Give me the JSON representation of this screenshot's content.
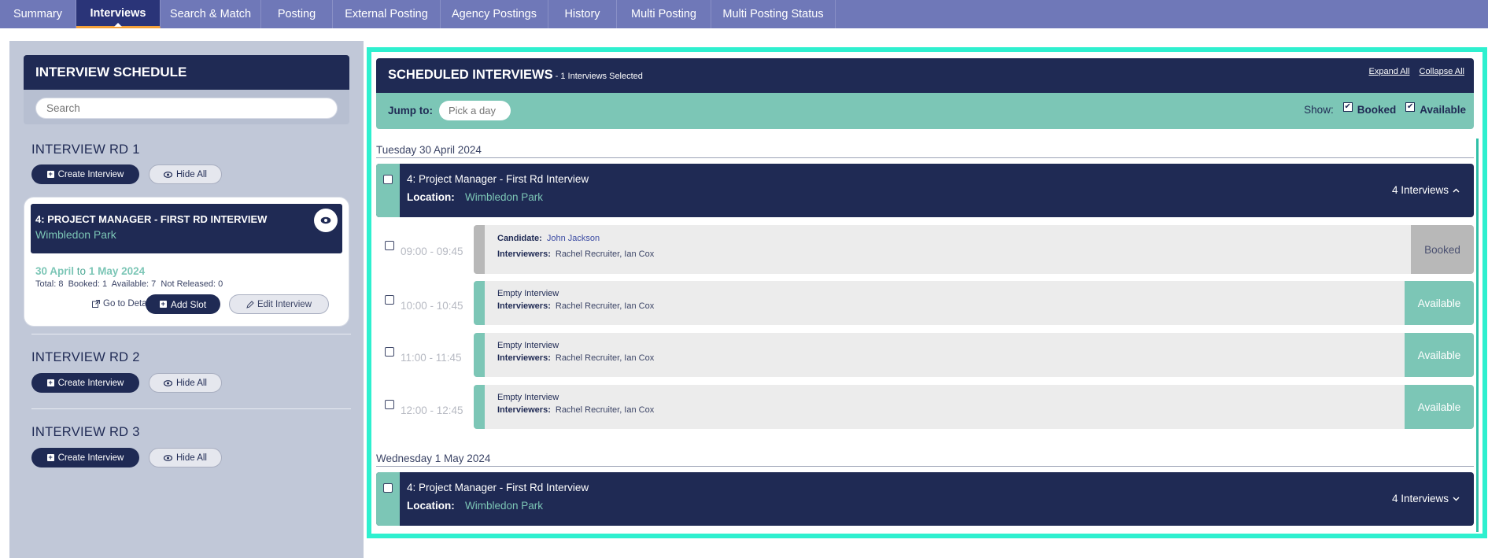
{
  "tabs": [
    {
      "label": "Summary",
      "active": false
    },
    {
      "label": "Interviews",
      "active": true
    },
    {
      "label": "Search & Match",
      "active": false
    },
    {
      "label": "Posting",
      "active": false
    },
    {
      "label": "External Posting",
      "active": false
    },
    {
      "label": "Agency Postings",
      "active": false
    },
    {
      "label": "History",
      "active": false
    },
    {
      "label": "Multi Posting",
      "active": false
    },
    {
      "label": "Multi Posting Status",
      "active": false
    }
  ],
  "left": {
    "title": "INTERVIEW SCHEDULE",
    "search_placeholder": "Search",
    "create_label": "Create Interview",
    "hide_label": "Hide All",
    "rounds": [
      {
        "title": "INTERVIEW RD 1"
      },
      {
        "title": "INTERVIEW RD 2"
      },
      {
        "title": "INTERVIEW RD 3"
      }
    ],
    "card": {
      "title": "4: PROJECT MANAGER - FIRST RD INTERVIEW",
      "location": "Wimbledon Park",
      "date_from": "30 April",
      "date_to_word": "to",
      "date_to": "1 May 2024",
      "stats": "Total: 8  Booked: 1  Available: 7  Not Released: 0",
      "detail_label": "Go to Detail",
      "add_slot_label": "Add Slot",
      "edit_label": "Edit Interview"
    }
  },
  "right": {
    "title": "SCHEDULED INTERVIEWS",
    "subtitle": "- 1 Interviews Selected",
    "expand_all": "Expand All",
    "collapse_all": "Collapse All",
    "jump_label": "Jump to:",
    "jump_placeholder": "Pick a day",
    "show_label": "Show:",
    "show_booked": "Booked",
    "show_available": "Available",
    "days": [
      {
        "date": "Tuesday 30 April 2024",
        "group": {
          "title": "4: Project Manager - First Rd Interview",
          "location_label": "Location:",
          "location": "Wimbledon Park",
          "count": "4 Interviews"
        },
        "slots": [
          {
            "time": "09:00 - 09:45",
            "line1_label": "Candidate:",
            "line1_value": "John Jackson",
            "line2_label": "Interviewers:",
            "line2_value": "Rachel Recruiter, Ian Cox",
            "status": "Booked"
          },
          {
            "time": "10:00 - 10:45",
            "line1_label": "Empty Interview",
            "line1_value": "",
            "line2_label": "Interviewers:",
            "line2_value": "Rachel Recruiter, Ian Cox",
            "status": "Available"
          },
          {
            "time": "11:00  -  11:45",
            "line1_label": "Empty Interview",
            "line1_value": "",
            "line2_label": "Interviewers:",
            "line2_value": "Rachel Recruiter, Ian Cox",
            "status": "Available"
          },
          {
            "time": "12:00  -  12:45",
            "line1_label": "Empty Interview",
            "line1_value": "",
            "line2_label": "Interviewers:",
            "line2_value": "Rachel Recruiter, Ian Cox",
            "status": "Available"
          }
        ]
      },
      {
        "date": "Wednesday 1 May 2024",
        "group": {
          "title": "4: Project Manager - First Rd Interview",
          "location_label": "Location:",
          "location": "Wimbledon Park",
          "count": "4 Interviews"
        }
      }
    ]
  },
  "colors": {
    "nav": "#6f78b8",
    "navy": "#1f2a54",
    "teal": "#7cc6b6",
    "highlight": "#2ef0cf",
    "booked": "#b8b8b8",
    "available": "#7cc6b6"
  }
}
